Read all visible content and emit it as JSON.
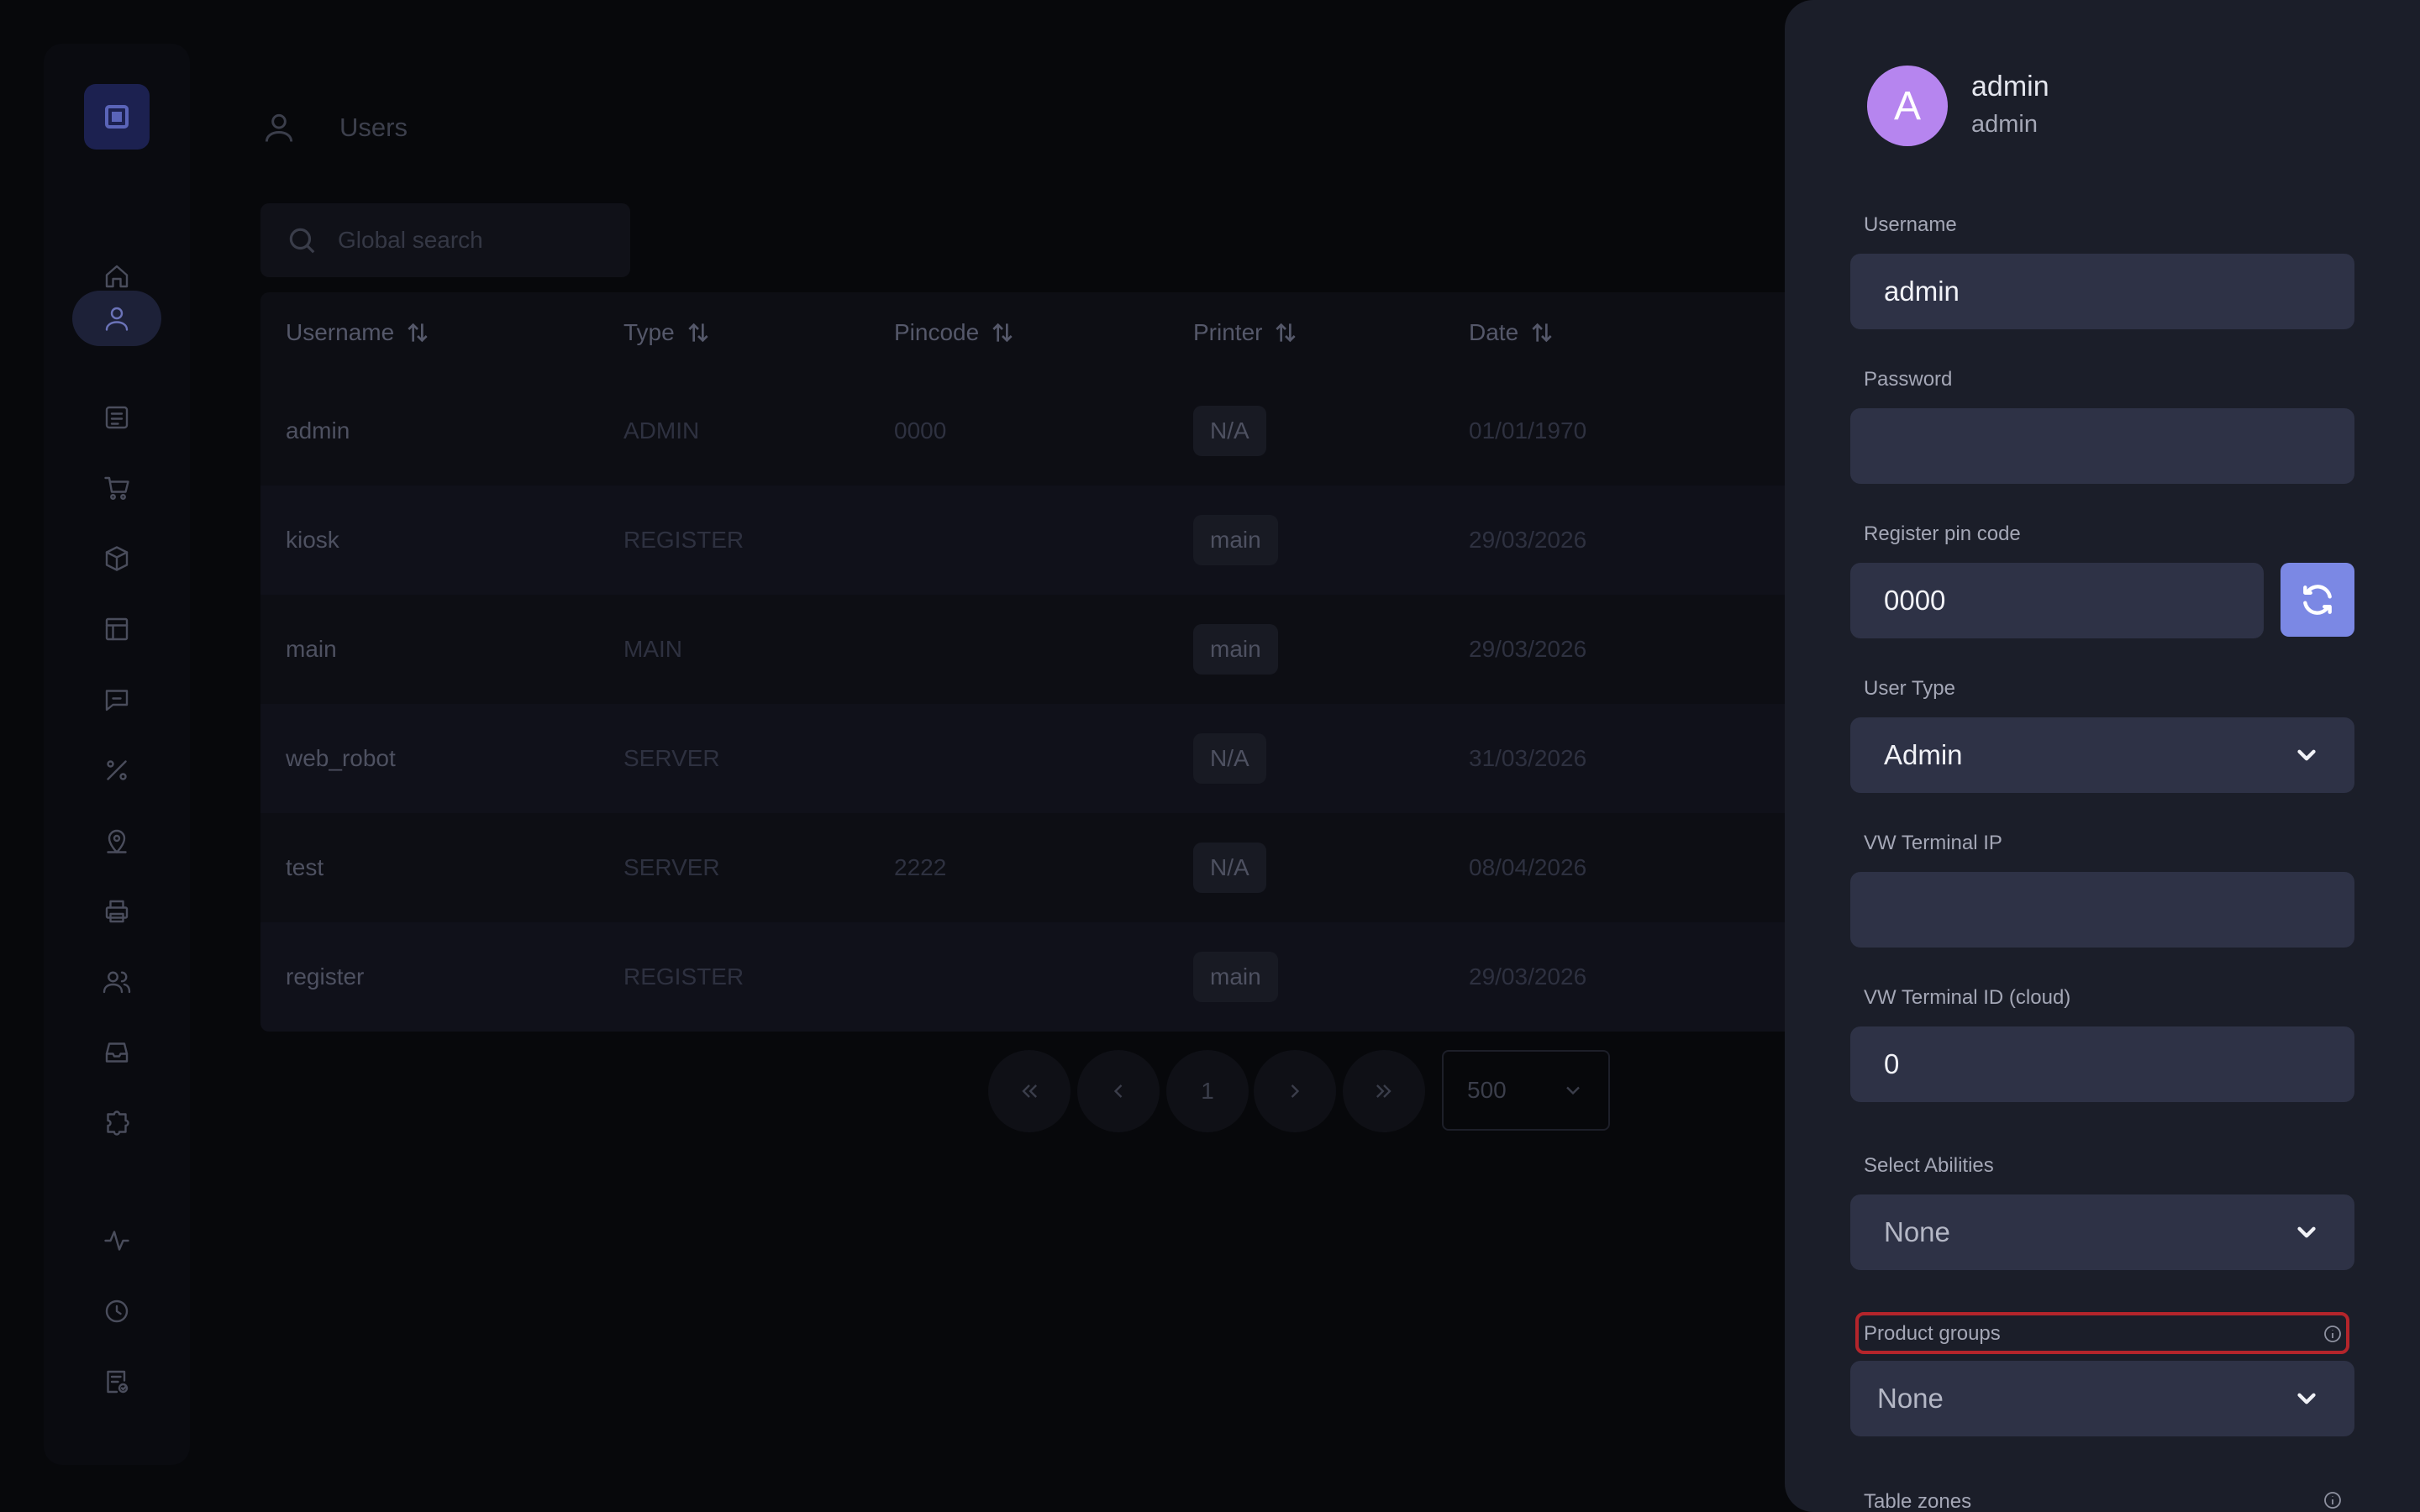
{
  "sidebar": {
    "items": [
      {
        "name": "home-icon"
      },
      {
        "name": "user-icon",
        "active": true
      },
      {
        "name": "orders-icon"
      },
      {
        "name": "cart-icon"
      },
      {
        "name": "box-icon"
      },
      {
        "name": "table-icon"
      },
      {
        "name": "message-icon"
      },
      {
        "name": "percent-icon"
      },
      {
        "name": "location-icon"
      },
      {
        "name": "printer-icon"
      },
      {
        "name": "users-icon"
      },
      {
        "name": "inbox-icon"
      },
      {
        "name": "puzzle-icon"
      },
      {
        "name": "activity-icon"
      },
      {
        "name": "clock-icon"
      },
      {
        "name": "report-icon"
      }
    ]
  },
  "header": {
    "title": "Users"
  },
  "search": {
    "placeholder": "Global search"
  },
  "table": {
    "columns": [
      "Username",
      "Type",
      "Pincode",
      "Printer",
      "Date"
    ],
    "rows": [
      {
        "username": "admin",
        "type": "ADMIN",
        "pincode": "0000",
        "printer": "N/A",
        "date": "01/01/1970"
      },
      {
        "username": "kiosk",
        "type": "REGISTER",
        "pincode": "",
        "printer": "main",
        "date": "29/03/2026"
      },
      {
        "username": "main",
        "type": "MAIN",
        "pincode": "",
        "printer": "main",
        "date": "29/03/2026"
      },
      {
        "username": "web_robot",
        "type": "SERVER",
        "pincode": "",
        "printer": "N/A",
        "date": "31/03/2026"
      },
      {
        "username": "test",
        "type": "SERVER",
        "pincode": "2222",
        "printer": "N/A",
        "date": "08/04/2026"
      },
      {
        "username": "register",
        "type": "REGISTER",
        "pincode": "",
        "printer": "main",
        "date": "29/03/2026"
      }
    ]
  },
  "pagination": {
    "current_page": "1",
    "page_size": "500"
  },
  "panel": {
    "avatar_letter": "A",
    "name": "admin",
    "role": "admin",
    "username_label": "Username",
    "username_value": "admin",
    "password_label": "Password",
    "password_value": "",
    "pincode_label": "Register pin code",
    "pincode_value": "0000",
    "user_type_label": "User Type",
    "user_type_value": "Admin",
    "terminal_ip_label": "VW Terminal IP",
    "terminal_ip_value": "",
    "terminal_id_label": "VW Terminal ID (cloud)",
    "terminal_id_value": "0",
    "abilities_label": "Select Abilities",
    "abilities_value": "None",
    "product_groups_label": "Product groups",
    "product_groups_value": "None",
    "table_zones_label": "Table zones",
    "accent_color": "#7b88e4",
    "avatar_color": "#b685ef",
    "highlight_color": "#b4252b"
  }
}
